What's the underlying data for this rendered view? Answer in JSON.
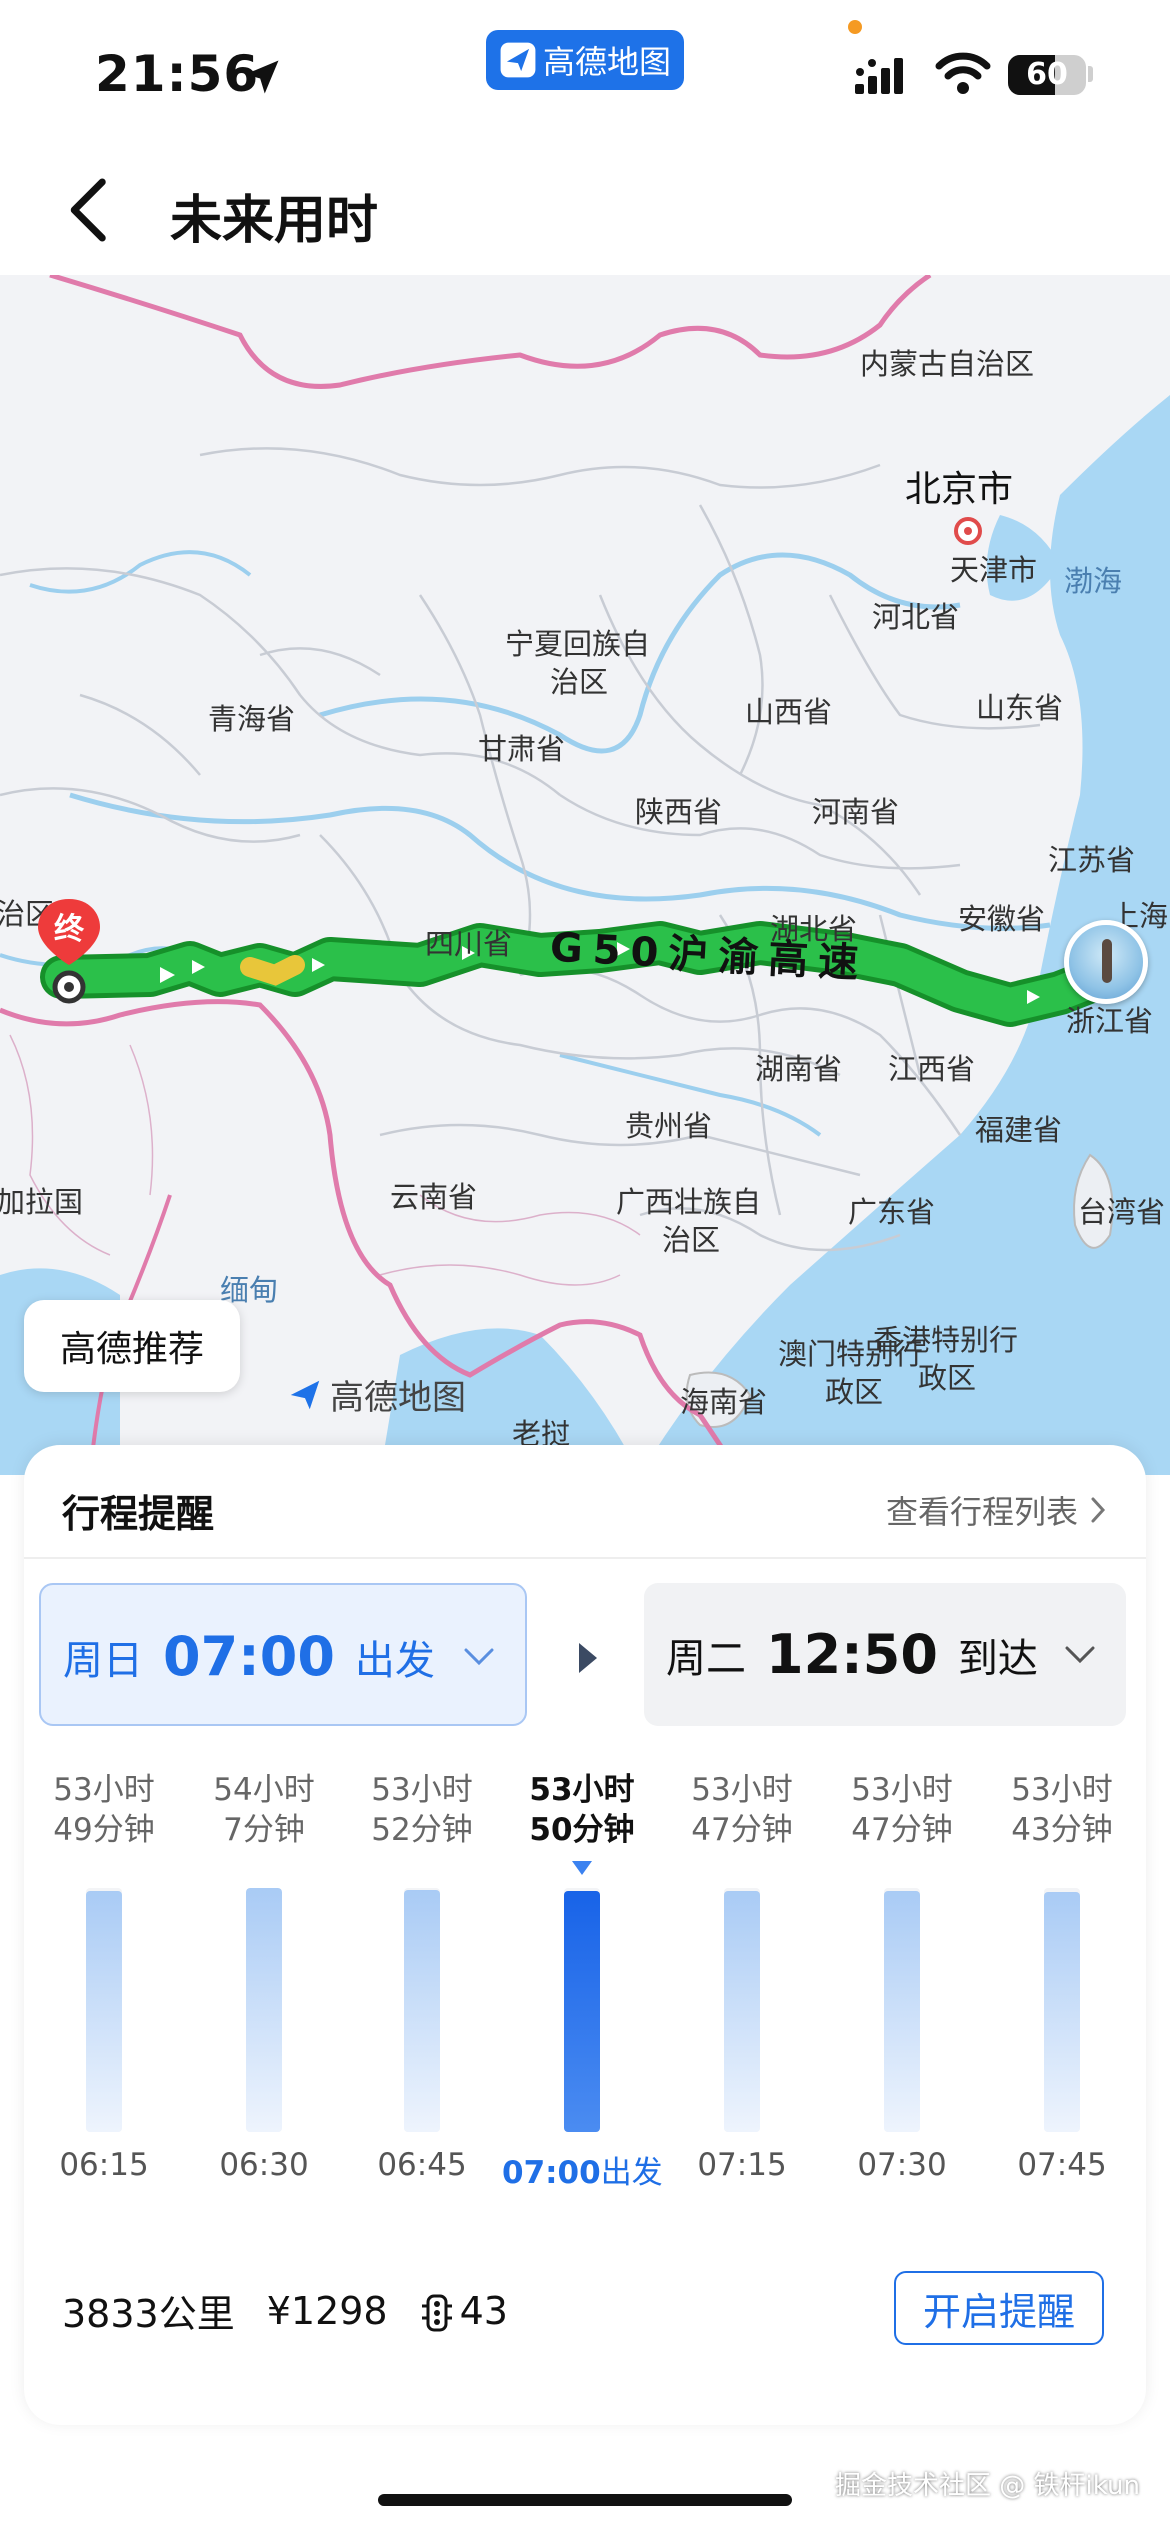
{
  "status_bar": {
    "time": "21:56",
    "app_pill": "高德地图",
    "battery": "60",
    "battery_level": 0.6
  },
  "header": {
    "title": "未来用时"
  },
  "map": {
    "places": [
      {
        "name": "内蒙古自治区",
        "kind": "region"
      },
      {
        "name": "北京市",
        "kind": "capital"
      },
      {
        "name": "天津市",
        "kind": "region"
      },
      {
        "name": "渤海",
        "kind": "sea"
      },
      {
        "name": "河北省",
        "kind": "region"
      },
      {
        "name": "宁夏回族自",
        "kind": "region"
      },
      {
        "name": "治区",
        "kind": "region"
      },
      {
        "name": "山西省",
        "kind": "region"
      },
      {
        "name": "山东省",
        "kind": "region"
      },
      {
        "name": "青海省",
        "kind": "region"
      },
      {
        "name": "甘肃省",
        "kind": "region"
      },
      {
        "name": "陕西省",
        "kind": "region"
      },
      {
        "name": "河南省",
        "kind": "region"
      },
      {
        "name": "江苏省",
        "kind": "region"
      },
      {
        "name": "治区",
        "kind": "region"
      },
      {
        "name": "四川省",
        "kind": "region"
      },
      {
        "name": "湖北省",
        "kind": "region"
      },
      {
        "name": "安徽省",
        "kind": "region"
      },
      {
        "name": "上海",
        "kind": "region"
      },
      {
        "name": "浙江省",
        "kind": "region"
      },
      {
        "name": "湖南省",
        "kind": "region"
      },
      {
        "name": "江西省",
        "kind": "region"
      },
      {
        "name": "贵州省",
        "kind": "region"
      },
      {
        "name": "福建省",
        "kind": "region"
      },
      {
        "name": "加拉国",
        "kind": "region"
      },
      {
        "name": "云南省",
        "kind": "region"
      },
      {
        "name": "广西壮族自",
        "kind": "region"
      },
      {
        "name": "治区",
        "kind": "region"
      },
      {
        "name": "广东省",
        "kind": "region"
      },
      {
        "name": "台湾省",
        "kind": "region"
      },
      {
        "name": "缅甸",
        "kind": "sea"
      },
      {
        "name": "香港特别行",
        "kind": "region"
      },
      {
        "name": "政区",
        "kind": "region"
      },
      {
        "name": "澳门特别行",
        "kind": "region"
      },
      {
        "name": "政区",
        "kind": "region"
      },
      {
        "name": "海南省",
        "kind": "region"
      },
      {
        "name": "老挝",
        "kind": "region"
      }
    ],
    "route_label": "G50沪渝高速",
    "end_marker": "终",
    "recommend_label": "高德推荐",
    "watermark": "高德地图"
  },
  "trip": {
    "title": "行程提醒",
    "list_link": "查看行程列表",
    "depart": {
      "day": "周日",
      "time": "07:00",
      "action": "出发"
    },
    "arrive": {
      "day": "周二",
      "time": "12:50",
      "action": "到达"
    },
    "slots": [
      {
        "h": "53小时",
        "m": "49分钟",
        "time": "06:15",
        "minutes": 3229,
        "selected": false
      },
      {
        "h": "54小时",
        "m": "7分钟",
        "time": "06:30",
        "minutes": 3247,
        "selected": false
      },
      {
        "h": "53小时",
        "m": "52分钟",
        "time": "06:45",
        "minutes": 3232,
        "selected": false
      },
      {
        "h": "53小时",
        "m": "50分钟",
        "time": "07:00",
        "suffix": "出发",
        "minutes": 3230,
        "selected": true
      },
      {
        "h": "53小时",
        "m": "47分钟",
        "time": "07:15",
        "minutes": 3227,
        "selected": false
      },
      {
        "h": "53小时",
        "m": "47分钟",
        "time": "07:30",
        "minutes": 3227,
        "selected": false
      },
      {
        "h": "53小时",
        "m": "43分钟",
        "time": "07:45",
        "minutes": 3223,
        "selected": false
      }
    ],
    "distance": "3833公里",
    "toll": "¥1298",
    "lights": "43",
    "remind_button": "开启提醒"
  },
  "watermark": "掘金技术社区 @ 铁杆ikun"
}
